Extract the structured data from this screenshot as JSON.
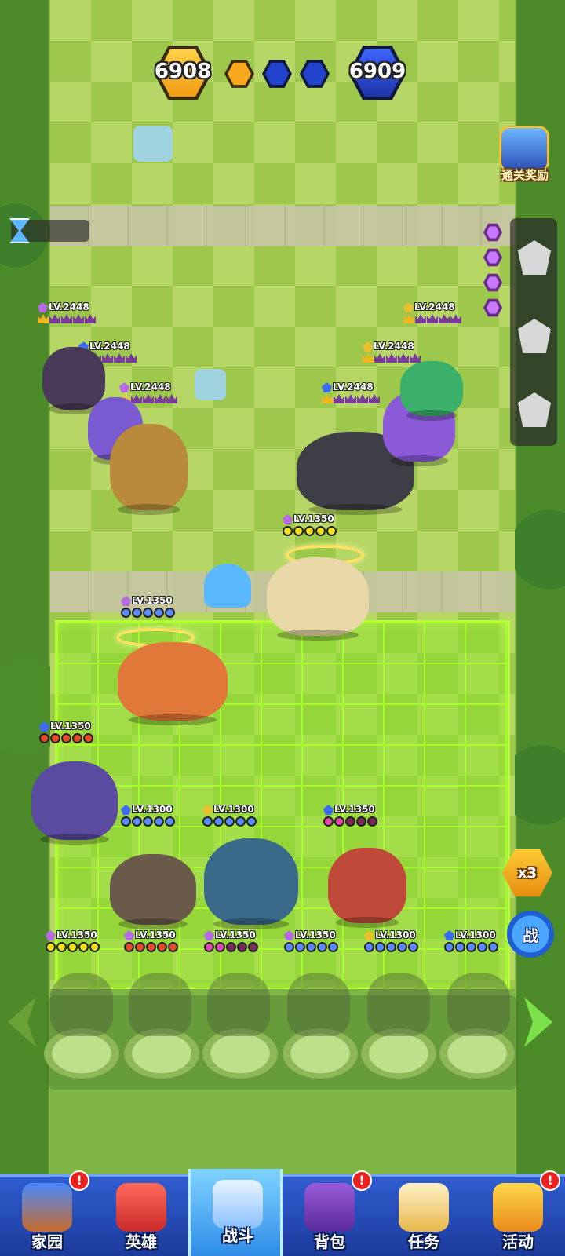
{
  "score": {
    "left": "6908",
    "right": "6909",
    "colors": {
      "gold": "#f7a81c",
      "blue": "#2244cc"
    }
  },
  "reward": {
    "label": "通关奖励",
    "icon": "trophy-book-icon"
  },
  "enemy_units": [
    {
      "level": "LV.2448",
      "gem_color": "#b66be0",
      "star_type": "crown"
    },
    {
      "level": "LV.2448",
      "gem_color": "#3c6cf0",
      "star_type": "crown"
    },
    {
      "level": "LV.2448",
      "gem_color": "#b66be0",
      "star_type": "crown"
    },
    {
      "level": "LV.2448",
      "gem_color": "#e8c030",
      "star_type": "crown"
    },
    {
      "level": "LV.2448",
      "gem_color": "#e8c030",
      "star_type": "crown"
    },
    {
      "level": "LV.2448",
      "gem_color": "#3c6cf0",
      "star_type": "crown"
    }
  ],
  "player_units": [
    {
      "level": "LV.1350",
      "gem_color": "#b66be0",
      "star_type": "lightning"
    },
    {
      "level": "LV.1350",
      "gem_color": "#b66be0",
      "star_type": "crescent"
    },
    {
      "level": "LV.1350",
      "gem_color": "#3c6cf0",
      "star_type": "flame"
    },
    {
      "level": "LV.1300",
      "gem_color": "#3c6cf0",
      "star_type": "crescent"
    },
    {
      "level": "LV.1300",
      "gem_color": "#e8c030",
      "star_type": "crescent"
    },
    {
      "level": "LV.1350",
      "gem_color": "#3c6cf0",
      "star_type": "rose"
    },
    {
      "level": "LV.1350",
      "gem_color": "#b66be0",
      "star_type": "lightning"
    },
    {
      "level": "LV.1350",
      "gem_color": "#b66be0",
      "star_type": "flame"
    },
    {
      "level": "LV.1350",
      "gem_color": "#b66be0",
      "star_type": "rose"
    },
    {
      "level": "LV.1350",
      "gem_color": "#b66be0",
      "star_type": "crescent"
    },
    {
      "level": "LV.1300",
      "gem_color": "#e8c030",
      "star_type": "crescent"
    },
    {
      "level": "LV.1300",
      "gem_color": "#3c6cf0",
      "star_type": "crescent"
    }
  ],
  "buttons": {
    "speed": "x3",
    "fight": "战"
  },
  "nav": [
    {
      "label": "家园",
      "icon": "home-castle-icon",
      "alert": "!"
    },
    {
      "label": "英雄",
      "icon": "hero-demon-icon",
      "alert": ""
    },
    {
      "label": "战斗",
      "icon": "crossed-swords-icon",
      "alert": ""
    },
    {
      "label": "背包",
      "icon": "treasure-chest-icon",
      "alert": "!"
    },
    {
      "label": "任务",
      "icon": "scroll-quest-icon",
      "alert": ""
    },
    {
      "label": "活动",
      "icon": "event-crown-icon",
      "alert": "!"
    }
  ]
}
